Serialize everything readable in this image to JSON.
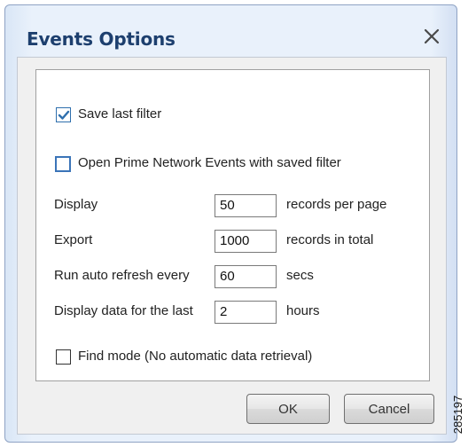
{
  "window": {
    "title": "Events Options",
    "close_icon": "close-icon"
  },
  "options": {
    "save_last_filter": {
      "label": "Save last filter",
      "checked": true
    },
    "open_with_saved": {
      "label": "Open Prime Network Events with saved filter",
      "checked": false
    },
    "find_mode": {
      "label": "Find mode (No automatic data retrieval)",
      "checked": false
    }
  },
  "fields": [
    {
      "label": "Display",
      "value": "50",
      "unit": "records per page"
    },
    {
      "label": "Export",
      "value": "1000",
      "unit": "records in total"
    },
    {
      "label": "Run auto refresh every",
      "value": "60",
      "unit": "secs"
    },
    {
      "label": "Display data for the last",
      "value": "2",
      "unit": "hours"
    }
  ],
  "buttons": {
    "ok": "OK",
    "cancel": "Cancel"
  },
  "figure_id": "285197",
  "colors": {
    "title": "#1d3f6e",
    "check": "#2f6fad",
    "frame": "#e9f1fb"
  }
}
